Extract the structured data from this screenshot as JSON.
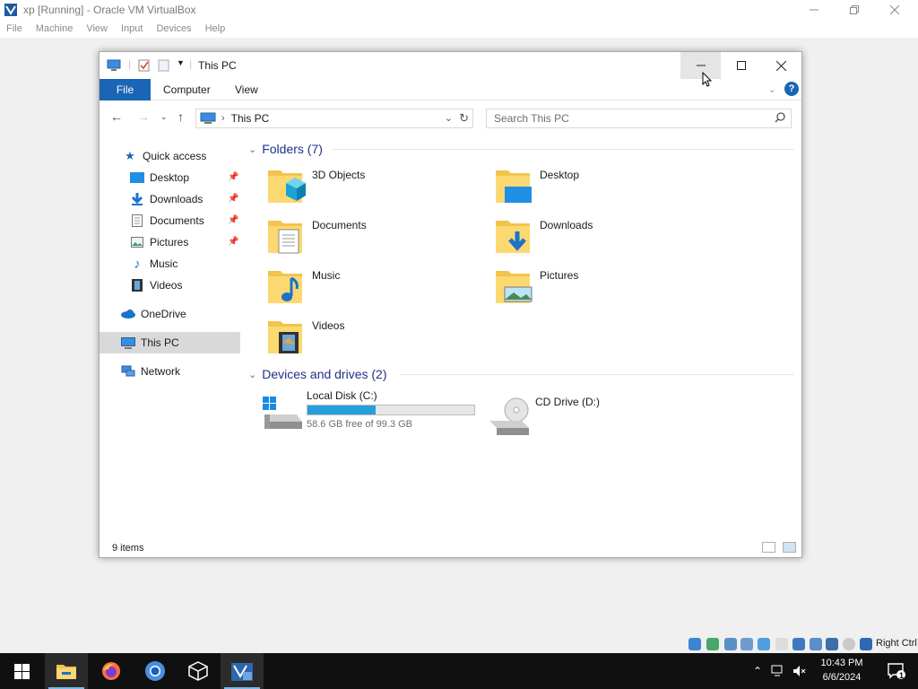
{
  "vbox": {
    "title": "xp [Running] - Oracle VM VirtualBox",
    "menu": [
      "File",
      "Machine",
      "View",
      "Input",
      "Devices",
      "Help"
    ],
    "status_right_label": "Right Ctrl"
  },
  "explorer": {
    "title": "This PC",
    "ribbon": {
      "file": "File",
      "computer": "Computer",
      "view": "View",
      "help": "?"
    },
    "address": {
      "crumb": "This PC"
    },
    "search": {
      "placeholder": "Search This PC"
    },
    "nav": {
      "quick_access": "Quick access",
      "items": [
        {
          "label": "Desktop",
          "pinned": true
        },
        {
          "label": "Downloads",
          "pinned": true
        },
        {
          "label": "Documents",
          "pinned": true
        },
        {
          "label": "Pictures",
          "pinned": true
        },
        {
          "label": "Music",
          "pinned": false
        },
        {
          "label": "Videos",
          "pinned": false
        }
      ],
      "onedrive": "OneDrive",
      "this_pc": "This PC",
      "network": "Network"
    },
    "folders_header": "Folders (7)",
    "folders": [
      "3D Objects",
      "Desktop",
      "Documents",
      "Downloads",
      "Music",
      "Pictures",
      "Videos"
    ],
    "drives_header": "Devices and drives (2)",
    "drives": [
      {
        "name": "Local Disk (C:)",
        "free_text": "58.6 GB free of 99.3 GB",
        "used_fraction": 0.41
      },
      {
        "name": "CD Drive (D:)"
      }
    ],
    "status": "9 items"
  },
  "taskbar": {
    "time": "10:43 PM",
    "date": "6/6/2024",
    "notification_count": "1"
  },
  "colors": {
    "accent": "#1a65b5",
    "group_header": "#1e3287",
    "drive_bar": "#26a0da",
    "taskbar": "#101010"
  }
}
